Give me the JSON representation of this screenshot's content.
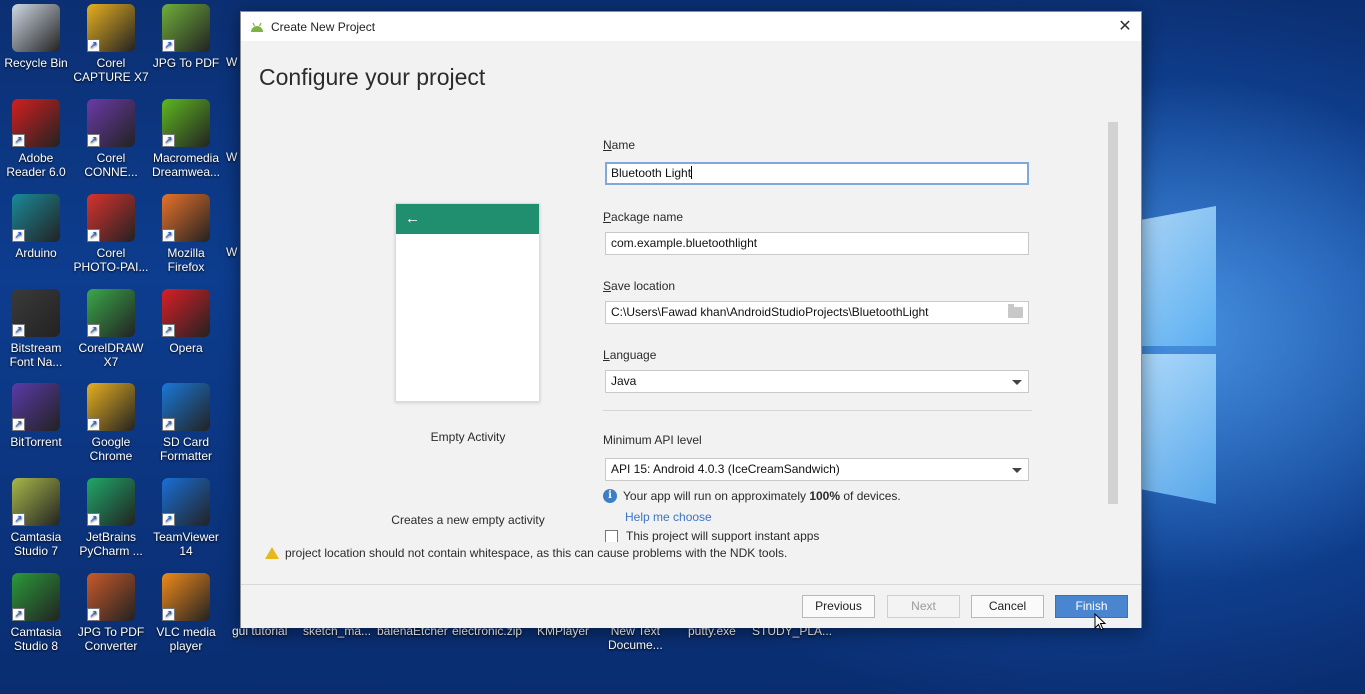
{
  "desktop": {
    "icons": [
      {
        "label": "Recycle Bin",
        "icon": "recycle-bin-icon",
        "color": "#cfd8e3"
      },
      {
        "label": "Corel\nCAPTURE X7",
        "icon": "corel-capture-icon",
        "color": "#e8b020"
      },
      {
        "label": "JPG To PDF",
        "icon": "jpg-to-pdf-icon",
        "color": "#6fae3a"
      },
      {
        "label": "Adobe\nReader 6.0",
        "icon": "adobe-reader-icon",
        "color": "#d21f1f"
      },
      {
        "label": "Corel\nCONNE...",
        "icon": "corel-connect-icon",
        "color": "#6b3aa8"
      },
      {
        "label": "Macromedia\nDreamwea...",
        "icon": "dreamweaver-icon",
        "color": "#5fb81f"
      },
      {
        "label": "Arduino",
        "icon": "arduino-icon",
        "color": "#1a8a9a"
      },
      {
        "label": "Corel\nPHOTO-PAI...",
        "icon": "corel-photo-paint-icon",
        "color": "#d8332e"
      },
      {
        "label": "Mozilla\nFirefox",
        "icon": "firefox-icon",
        "color": "#e8722a"
      },
      {
        "label": "Bitstream\nFont Na...",
        "icon": "bitstream-font-icon",
        "color": "#3a3a3a"
      },
      {
        "label": "CorelDRAW\nX7",
        "icon": "coreldraw-icon",
        "color": "#3aa84a"
      },
      {
        "label": "Opera",
        "icon": "opera-icon",
        "color": "#d81f26"
      },
      {
        "label": "BitTorrent",
        "icon": "bittorrent-icon",
        "color": "#5a3aa8"
      },
      {
        "label": "Google\nChrome",
        "icon": "chrome-icon",
        "color": "#e8b020"
      },
      {
        "label": "SD Card\nFormatter",
        "icon": "sd-card-icon",
        "color": "#1a78d8"
      },
      {
        "label": "Camtasia\nStudio 7",
        "icon": "camtasia-7-icon",
        "color": "#a8b84a"
      },
      {
        "label": "JetBrains\nPyCharm ...",
        "icon": "pycharm-icon",
        "color": "#1fa86a"
      },
      {
        "label": "TeamViewer\n14",
        "icon": "teamviewer-icon",
        "color": "#1a6fd8"
      },
      {
        "label": "Camtasia\nStudio 8",
        "icon": "camtasia-8-icon",
        "color": "#2a9a3a"
      },
      {
        "label": "JPG To PDF\nConverter",
        "icon": "jpg-pdf-converter-icon",
        "color": "#c85a2a"
      },
      {
        "label": "VLC media\nplayer",
        "icon": "vlc-icon",
        "color": "#f08a1a"
      }
    ],
    "bottom_labels": [
      "gui tutorial",
      "sketch_ma...",
      "balenaEtcher",
      "electronic.zip",
      "KMPlayer",
      "New Text\nDocume...",
      "putty.exe",
      "STUDY_PLA..."
    ],
    "partial_labels": [
      "W",
      "W",
      "W"
    ]
  },
  "dialog": {
    "title": "Create New Project",
    "heading": "Configure your project",
    "preview": {
      "back_arrow": "←",
      "activity_name": "Empty Activity",
      "activity_description": "Creates a new empty activity",
      "toolbar_color": "#1f8f6f"
    },
    "form": {
      "name_label": "Name",
      "name_value": "Bluetooth Light",
      "package_label": "Package name",
      "package_value": "com.example.bluetoothlight",
      "save_label": "Save location",
      "save_value": "C:\\Users\\Fawad khan\\AndroidStudioProjects\\BluetoothLight",
      "language_label": "Language",
      "language_value": "Java",
      "min_api_label": "Minimum API level",
      "min_api_value": "API 15: Android 4.0.3 (IceCreamSandwich)",
      "info_prefix": "Your app will run on approximately ",
      "info_percent": "100%",
      "info_suffix": " of devices.",
      "help_link": "Help me choose",
      "instant_apps_label": "This project will support instant apps"
    },
    "warning": "project location should not contain whitespace, as this can cause problems with the NDK tools.",
    "buttons": {
      "previous": "Previous",
      "next": "Next",
      "cancel": "Cancel",
      "finish": "Finish"
    }
  }
}
